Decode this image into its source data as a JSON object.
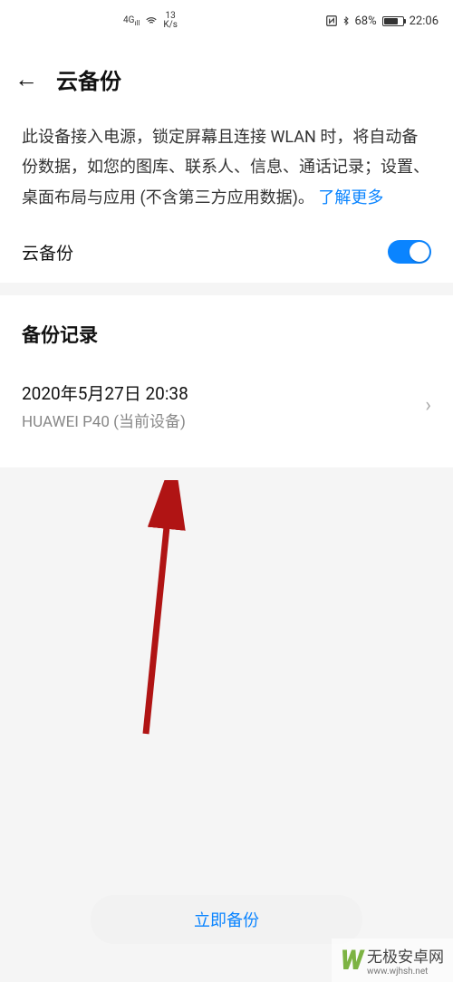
{
  "status": {
    "signal_label": "4G",
    "speed": "13\nK/s",
    "nfc_icon": "nfc",
    "bt_icon": "bluetooth",
    "battery_pct": "68%",
    "time": "22:06"
  },
  "header": {
    "back_icon": "←",
    "title": "云备份"
  },
  "description": {
    "text": "此设备接入电源，锁定屏幕且连接 WLAN 时，将自动备份数据，如您的图库、联系人、信息、通话记录；设置、桌面布局与应用 (不含第三方应用数据)。",
    "learn_more": "了解更多"
  },
  "toggle": {
    "label": "云备份",
    "value": true
  },
  "records": {
    "title": "备份记录",
    "items": [
      {
        "date": "2020年5月27日 20:38",
        "device": "HUAWEI P40 (当前设备)"
      }
    ]
  },
  "cta": {
    "backup_now": "立即备份"
  },
  "watermark": {
    "brand": "无极安卓网",
    "url": "www.wjhsh.net"
  }
}
